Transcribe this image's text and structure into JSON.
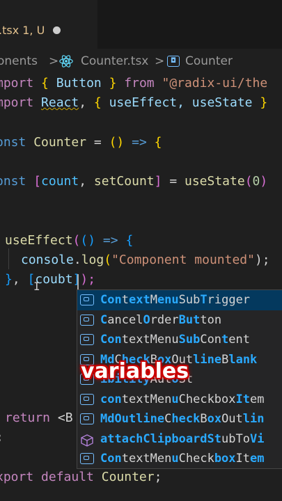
{
  "tab": {
    "label": ".tsx 1, U"
  },
  "breadcrumb": {
    "folder": "onents",
    "sep1": ">",
    "file": "Counter.tsx",
    "sep2": ">",
    "symbol": "Counter"
  },
  "code": {
    "l1": {
      "kw": "mport",
      "open": "{",
      "name": "Button",
      "close": "}",
      "from": "from",
      "str": "\"@radix-ui/the"
    },
    "l2": {
      "kw": "mport",
      "react": "React",
      "comma": ",",
      "open": "{",
      "names": "useEffect, useState",
      "close": "}"
    },
    "l3": {
      "kw": "onst",
      "name": "Counter",
      "eq": "=",
      "parens": "()",
      "arrow": "=>",
      "brace": "{"
    },
    "l4": {
      "kw": "onst",
      "open": "[",
      "a": "count",
      "comma": ",",
      "b": "setCount",
      "close": "]",
      "eq": "=",
      "fn": "useState",
      "po": "(",
      "num": "0",
      "pc": ")"
    },
    "l5": {
      "fn": "useEffect",
      "po": "(",
      "pp": "()",
      "arrow": "=>",
      "brace": "{"
    },
    "l6": {
      "obj": "console",
      "dot": ".",
      "fn": "log",
      "po": "(",
      "str": "\"Component mounted\"",
      "pc": ");"
    },
    "l7": {
      "brace": "}",
      "comma": ",",
      "bo": "[",
      "typed": "coubt",
      "bc": "]",
      "pc": ");"
    },
    "l8": {
      "kw": "return",
      "tag": "<B"
    },
    "l9": {
      "semi": ";"
    },
    "l10": {
      "kw": "xport",
      "kw2": "default",
      "name": "Counter",
      "semi": ";"
    }
  },
  "suggestions": [
    {
      "icon": "variable-icon",
      "parts": [
        "Con",
        "t",
        "ext",
        "M",
        "enu",
        "Sub",
        "T",
        "rigger"
      ]
    },
    {
      "icon": "variable-icon",
      "parts": [
        "C",
        "ancel",
        "O",
        "rder",
        "But",
        "ton"
      ]
    },
    {
      "icon": "variable-icon",
      "parts": [
        "Con",
        "textMenu",
        "Sub",
        "Con",
        "t",
        "ent"
      ]
    },
    {
      "icon": "variable-icon",
      "parts": [
        "Md",
        "C",
        "heck",
        "B",
        "ox",
        "Out",
        "line",
        "B",
        "lank"
      ]
    },
    {
      "icon": "variable-icon",
      "parts": [
        "",
        "",
        "ibility",
        "Aut",
        "o",
        "St"
      ]
    },
    {
      "icon": "variable-icon",
      "parts": [
        "con",
        "textMen",
        "u",
        "Checkbox",
        "It",
        "em"
      ]
    },
    {
      "icon": "variable-icon",
      "parts": [
        "MdOutline",
        "C",
        "heck",
        "B",
        "ox",
        "Out",
        "lin"
      ]
    },
    {
      "icon": "cube-icon",
      "parts": [
        "attachClipboardSt",
        "ubTo",
        "Vi"
      ]
    },
    {
      "icon": "variable-icon",
      "parts": [
        "Con",
        "textMen",
        "u",
        "Check",
        "box",
        "It",
        "em"
      ]
    }
  ],
  "caption": "variables"
}
